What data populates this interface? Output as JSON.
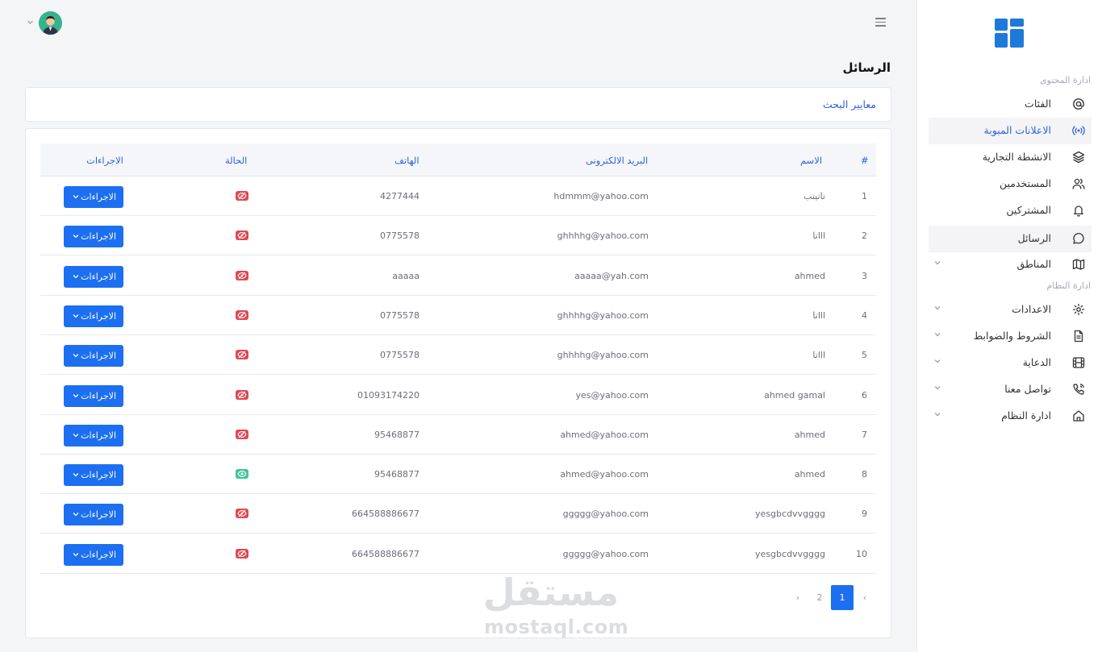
{
  "page_title": "الرسائل",
  "search_card_link": "معايير البحث",
  "sidebar": {
    "sections": [
      {
        "title": "ادارة المحتوى"
      },
      {
        "title": "ادارة النظام"
      }
    ],
    "items": [
      {
        "label": "الفئات",
        "icon": "at-sign-icon"
      },
      {
        "label": "الاعلانات المبوبة",
        "icon": "broadcast-icon"
      },
      {
        "label": "الانشطة التجارية",
        "icon": "layers-icon"
      },
      {
        "label": "المستخدمين",
        "icon": "users-icon"
      },
      {
        "label": "المشتركين",
        "icon": "bell-icon"
      },
      {
        "label": "الرسائل",
        "icon": "message-circle-icon"
      },
      {
        "label": "المناطق",
        "icon": "map-icon"
      },
      {
        "label": "الاعدادات",
        "icon": "gear-icon"
      },
      {
        "label": "الشروط والضوابط",
        "icon": "document-icon"
      },
      {
        "label": "الدعاية",
        "icon": "film-icon"
      },
      {
        "label": "تواصل معنا",
        "icon": "phone-icon"
      },
      {
        "label": "ادارة النظام",
        "icon": "home-icon"
      }
    ]
  },
  "table": {
    "headers": {
      "index": "#",
      "name": "الاسم",
      "email": "البريد الالكترونى",
      "phone": "الهاتف",
      "status": "الحالة",
      "actions": "الاجراءات"
    },
    "action_label": "الاجراءات",
    "rows": [
      {
        "index": "1",
        "name": "تاتيتب",
        "email": "hdmmm@yahoo.com",
        "phone": "4277444",
        "status": "hidden"
      },
      {
        "index": "2",
        "name": "تاlll",
        "email": "ghhhhg@yahoo.com",
        "phone": "0775578",
        "status": "hidden"
      },
      {
        "index": "3",
        "name": "ahmed",
        "email": "aaaaa@yah.com",
        "phone": "aaaaa",
        "status": "hidden"
      },
      {
        "index": "4",
        "name": "تاlll",
        "email": "ghhhhg@yahoo.com",
        "phone": "0775578",
        "status": "hidden"
      },
      {
        "index": "5",
        "name": "تاlll",
        "email": "ghhhhg@yahoo.com",
        "phone": "0775578",
        "status": "hidden"
      },
      {
        "index": "6",
        "name": "ahmed gamal",
        "email": "yes@yahoo.com",
        "phone": "01093174220",
        "status": "hidden"
      },
      {
        "index": "7",
        "name": "ahmed",
        "email": "ahmed@yahoo.com",
        "phone": "95468877",
        "status": "hidden"
      },
      {
        "index": "8",
        "name": "ahmed",
        "email": "ahmed@yahoo.com",
        "phone": "95468877",
        "status": "visible"
      },
      {
        "index": "9",
        "name": "yesgbcdvvgggg",
        "email": "ggggg@yahoo.com",
        "phone": "664588886677",
        "status": "hidden"
      },
      {
        "index": "10",
        "name": "yesgbcdvvgggg",
        "email": "ggggg@yahoo.com",
        "phone": "664588886677",
        "status": "hidden"
      }
    ]
  },
  "pagination": {
    "prev": "‹",
    "pages": [
      "1",
      "2"
    ],
    "current": "1",
    "next": "›"
  },
  "watermark": {
    "arabic": "مستقل",
    "latin": "mostaql.com"
  },
  "colors": {
    "accent": "#1c6ff0",
    "link": "#2d63d8",
    "status_off": "#e04650",
    "status_on": "#3fc49a",
    "logo": "#1e7ad8"
  }
}
